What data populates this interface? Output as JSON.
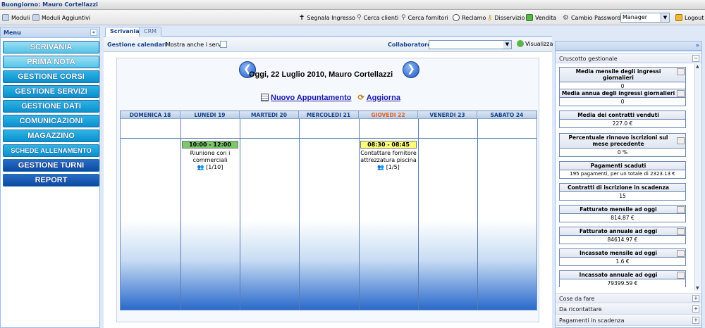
{
  "greeting": "Buongiorno: Mauro Cortellazzi",
  "toolbar": {
    "moduli": "Moduli",
    "moduli_aggiuntivi": "Moduli Aggiuntivi",
    "segnala_ingresso": "Segnala Ingresso",
    "cerca_clienti": "Cerca clienti",
    "cerca_fornitori": "Cerca fornitori",
    "reclamo": "Reclamo",
    "disservizio": "Disservizio",
    "vendita": "Vendita",
    "cambio_password": "Cambio Password",
    "role": "Manager",
    "logout": "Logout"
  },
  "menu": {
    "title": "Menu",
    "items": [
      "SCRIVANIA",
      "PRIMA NOTA",
      "GESTIONE CORSI",
      "GESTIONE SERVIZI",
      "GESTIONE DATI",
      "COMUNICAZIONI",
      "MAGAZZINO",
      "SCHEDE ALLENAMENTO",
      "GESTIONE TURNI",
      "REPORT"
    ]
  },
  "tabs": [
    "Scrivania",
    "CRM"
  ],
  "calendar": {
    "title": "Gestione calendari",
    "show_services": "Mostra anche i servizi",
    "collaboratore": "Collaboratore:",
    "visualizza": "Visualizza",
    "today": "Oggi, 22 Luglio 2010, Mauro Cortellazzi",
    "new_appt": "Nuovo Appuntamento",
    "refresh": "Aggiorna",
    "days": [
      "DOMENICA 18",
      "LUNEDI 19",
      "MARTEDI 20",
      "MERCOLEDI 21",
      "GIOVEDI 22",
      "VENERDI 23",
      "SABATO 24"
    ],
    "today_color": "#e06020",
    "appointments": [
      {
        "time": "10:00 - 12:00",
        "desc": "Riunione con i commerciali",
        "count": "[1/10]",
        "color": "#7bc86c"
      },
      {
        "time": "08:30 - 08:45",
        "desc": "Contattare fornitore attrezzatura piscina",
        "count": "[1/5]",
        "color": "#ffff7a"
      }
    ]
  },
  "right": {
    "title": "Cruscotto gestionale",
    "stats": [
      {
        "label": "Media mensile degli ingressi giornalieri",
        "value": "0"
      },
      {
        "label": "Media annua degli ingressi giornalieri",
        "value": "0"
      },
      {
        "label": "Media dei contratti venduti",
        "value": "227.0 €"
      },
      {
        "label": "Percentuale rinnovo iscrizioni sul mese precedente",
        "value": "0 %"
      },
      {
        "label": "Pagamenti scaduti",
        "value": "195 pagamenti, per un totale di 2323.13 €"
      },
      {
        "label": "Contratti di iscrizione in scadenza",
        "value": "15"
      },
      {
        "label": "Fatturato mensile ad oggi",
        "value": "814.87 €"
      },
      {
        "label": "Fatturato annuale ad oggi",
        "value": "84614.97 €"
      },
      {
        "label": "Incassato mensile ad oggi",
        "value": "1.6 €"
      },
      {
        "label": "Incassato annuale ad oggi",
        "value": "79399.59 €"
      }
    ],
    "sections": [
      "Cose da fare",
      "Da ricontattare",
      "Pagamenti in scadenza"
    ]
  }
}
